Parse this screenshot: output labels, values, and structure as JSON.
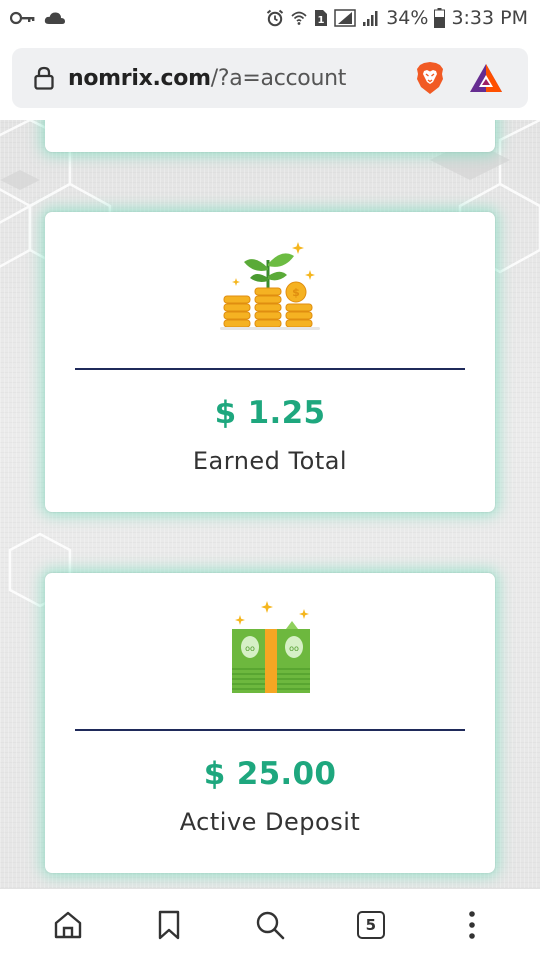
{
  "status_bar": {
    "battery": "34%",
    "time": "3:33 PM",
    "icons": [
      "key-icon",
      "cloud-icon",
      "alarm-icon",
      "wifi-icon",
      "sim-icon",
      "network-icon",
      "signal-icon",
      "battery-icon"
    ]
  },
  "browser": {
    "url_host": "nomrix.com",
    "url_path": "/?a=account",
    "icons": [
      "lock-icon",
      "brave-shield-icon",
      "bat-rewards-icon"
    ],
    "tab_count": "5",
    "toolbar_icons": [
      "home-icon",
      "bookmark-icon",
      "search-icon",
      "tabs-icon",
      "more-icon"
    ]
  },
  "cards": {
    "earned": {
      "amount": "$ 1.25",
      "label": "Earned Total",
      "icon": "coins-plant-icon"
    },
    "deposit": {
      "amount": "$ 25.00",
      "label": "Active Deposit",
      "icon": "money-stack-icon"
    }
  },
  "colors": {
    "accent_green": "#1ea77e",
    "divider_navy": "#1f2a5a",
    "card_glow": "#6edcb9",
    "brave_orange": "#f15a24"
  }
}
